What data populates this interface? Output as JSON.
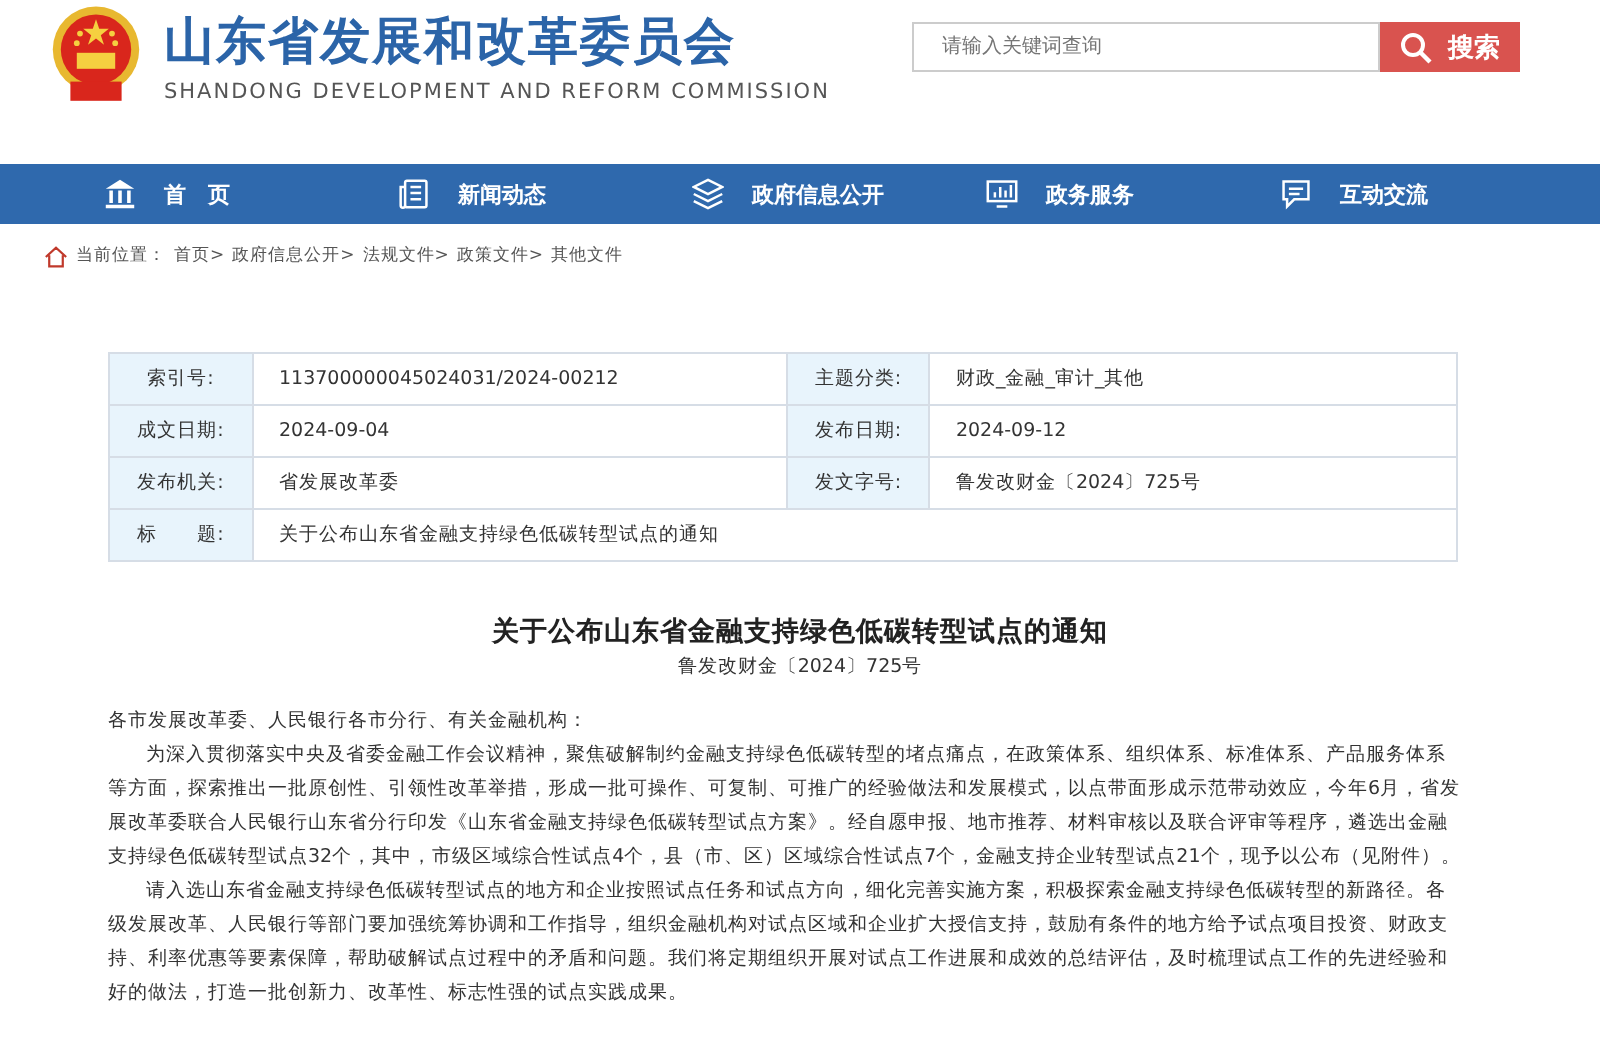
{
  "header": {
    "title": "山东省发展和改革委员会",
    "subtitle": "SHANDONG DEVELOPMENT AND REFORM COMMISSION",
    "search": {
      "placeholder": "请输入关键词查询",
      "button": "搜索"
    }
  },
  "nav": [
    {
      "label": "首　页",
      "kind": "home"
    },
    {
      "label": "新闻动态",
      "kind": "news"
    },
    {
      "label": "政府信息公开",
      "kind": "layers"
    },
    {
      "label": "政务服务",
      "kind": "service"
    },
    {
      "label": "互动交流",
      "kind": "chat"
    }
  ],
  "breadcrumb": {
    "label": "当前位置：",
    "items": [
      "首页>",
      "政府信息公开>",
      "法规文件>",
      "政策文件>",
      "其他文件"
    ]
  },
  "meta": [
    [
      {
        "label": "索引号:",
        "value": "113700000045024031/2024-00212"
      },
      {
        "label": "主题分类:",
        "value": "财政_金融_审计_其他"
      }
    ],
    [
      {
        "label": "成文日期:",
        "value": "2024-09-04"
      },
      {
        "label": "发布日期:",
        "value": "2024-09-12"
      }
    ],
    [
      {
        "label": "发布机关:",
        "value": "省发展改革委"
      },
      {
        "label": "发文字号:",
        "value": "鲁发改财金〔2024〕725号"
      }
    ],
    [
      {
        "label": "标　　题:",
        "value": "关于公布山东省金融支持绿色低碳转型试点的通知"
      }
    ]
  ],
  "article": {
    "title": "关于公布山东省金融支持绿色低碳转型试点的通知",
    "doc_number": "鲁发改财金〔2024〕725号",
    "salutation": "各市发展改革委、人民银行各市分行、有关金融机构：",
    "paragraphs": [
      "为深入贯彻落实中央及省委金融工作会议精神，聚焦破解制约金融支持绿色低碳转型的堵点痛点，在政策体系、组织体系、标准体系、产品服务体系等方面，探索推出一批原创性、引领性改革举措，形成一批可操作、可复制、可推广的经验做法和发展模式，以点带面形成示范带动效应，今年6月，省发展改革委联合人民银行山东省分行印发《山东省金融支持绿色低碳转型试点方案》。经自愿申报、地市推荐、材料审核以及联合评审等程序，遴选出金融支持绿色低碳转型试点32个，其中，市级区域综合性试点4个，县（市、区）区域综合性试点7个，金融支持企业转型试点21个，现予以公布（见附件）。",
      "请入选山东省金融支持绿色低碳转型试点的地方和企业按照试点任务和试点方向，细化完善实施方案，积极探索金融支持绿色低碳转型的新路径。各级发展改革、人民银行等部门要加强统筹协调和工作指导，组织金融机构对试点区域和企业扩大授信支持，鼓励有条件的地方给予试点项目投资、财政支持、利率优惠等要素保障，帮助破解试点过程中的矛盾和问题。我们将定期组织开展对试点工作进展和成效的总结评估，及时梳理试点工作的先进经验和好的做法，打造一批创新力、改革性、标志性强的试点实践成果。"
    ]
  }
}
